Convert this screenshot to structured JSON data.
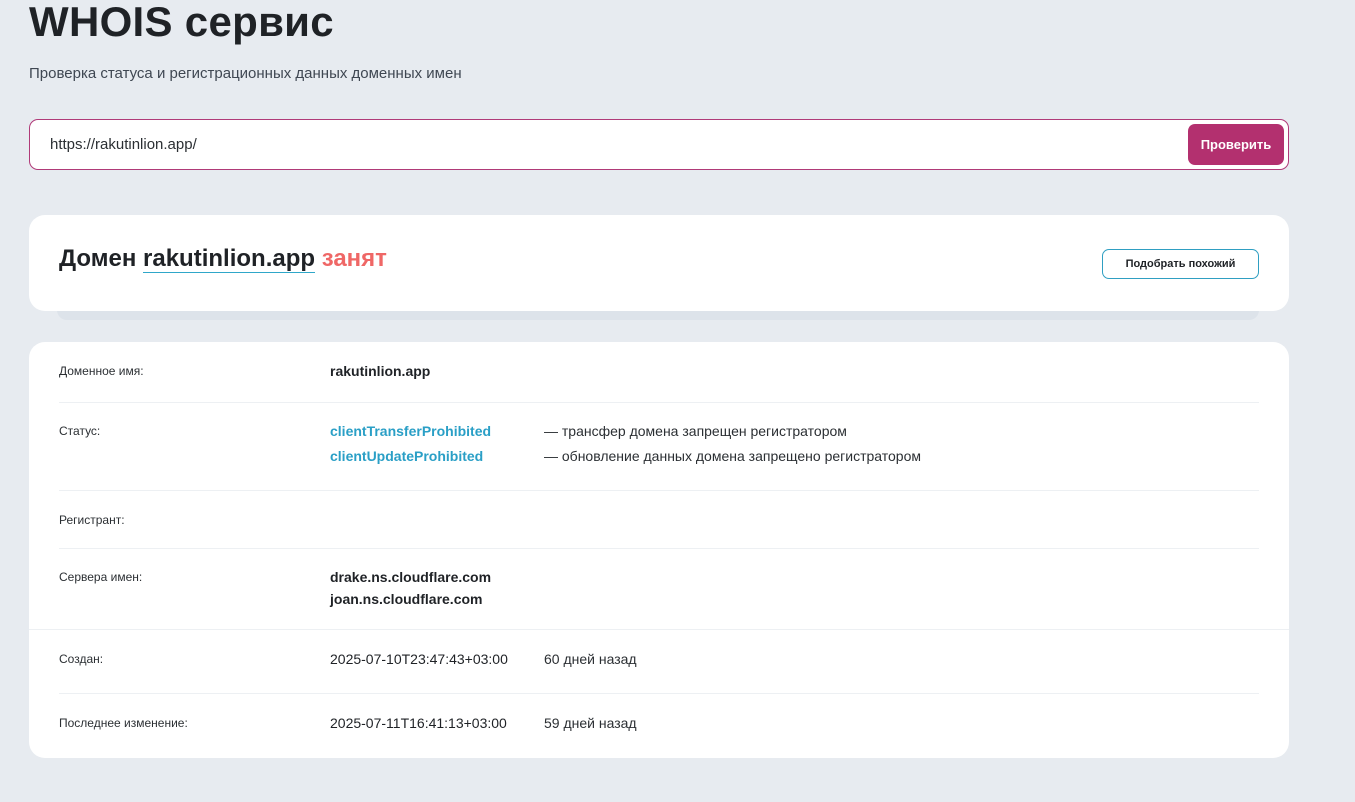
{
  "header": {
    "title": "WHOIS сервис",
    "subtitle": "Проверка статуса и регистрационных данных доменных имен"
  },
  "search": {
    "value": "https://rakutinlion.app/",
    "button_label": "Проверить"
  },
  "result": {
    "prefix": "Домен",
    "domain": "rakutinlion.app",
    "status_word": "занят",
    "similar_button_label": "Подобрать похожий",
    "busy_color": "#ef6766"
  },
  "details": {
    "domain_name": {
      "label": "Доменное имя:",
      "value": "rakutinlion.app"
    },
    "status": {
      "label": "Статус:",
      "items": [
        {
          "code": "clientTransferProhibited",
          "desc": "— трансфер домена запрещен регистратором"
        },
        {
          "code": "clientUpdateProhibited",
          "desc": "— обновление данных домена запрещено регистратором"
        }
      ]
    },
    "registrant": {
      "label": "Регистрант:",
      "value": ""
    },
    "nameservers": {
      "label": "Сервера имен:",
      "items": [
        "drake.ns.cloudflare.com",
        "joan.ns.cloudflare.com"
      ]
    },
    "created": {
      "label": "Создан:",
      "value": "2025-07-10T23:47:43+03:00",
      "ago": "60 дней назад"
    },
    "updated": {
      "label": "Последнее изменение:",
      "value": "2025-07-11T16:41:13+03:00",
      "ago": "59 дней назад"
    }
  },
  "colors": {
    "accent": "#b3306f",
    "link": "#2a9fc6",
    "background": "#e7ebf0"
  }
}
